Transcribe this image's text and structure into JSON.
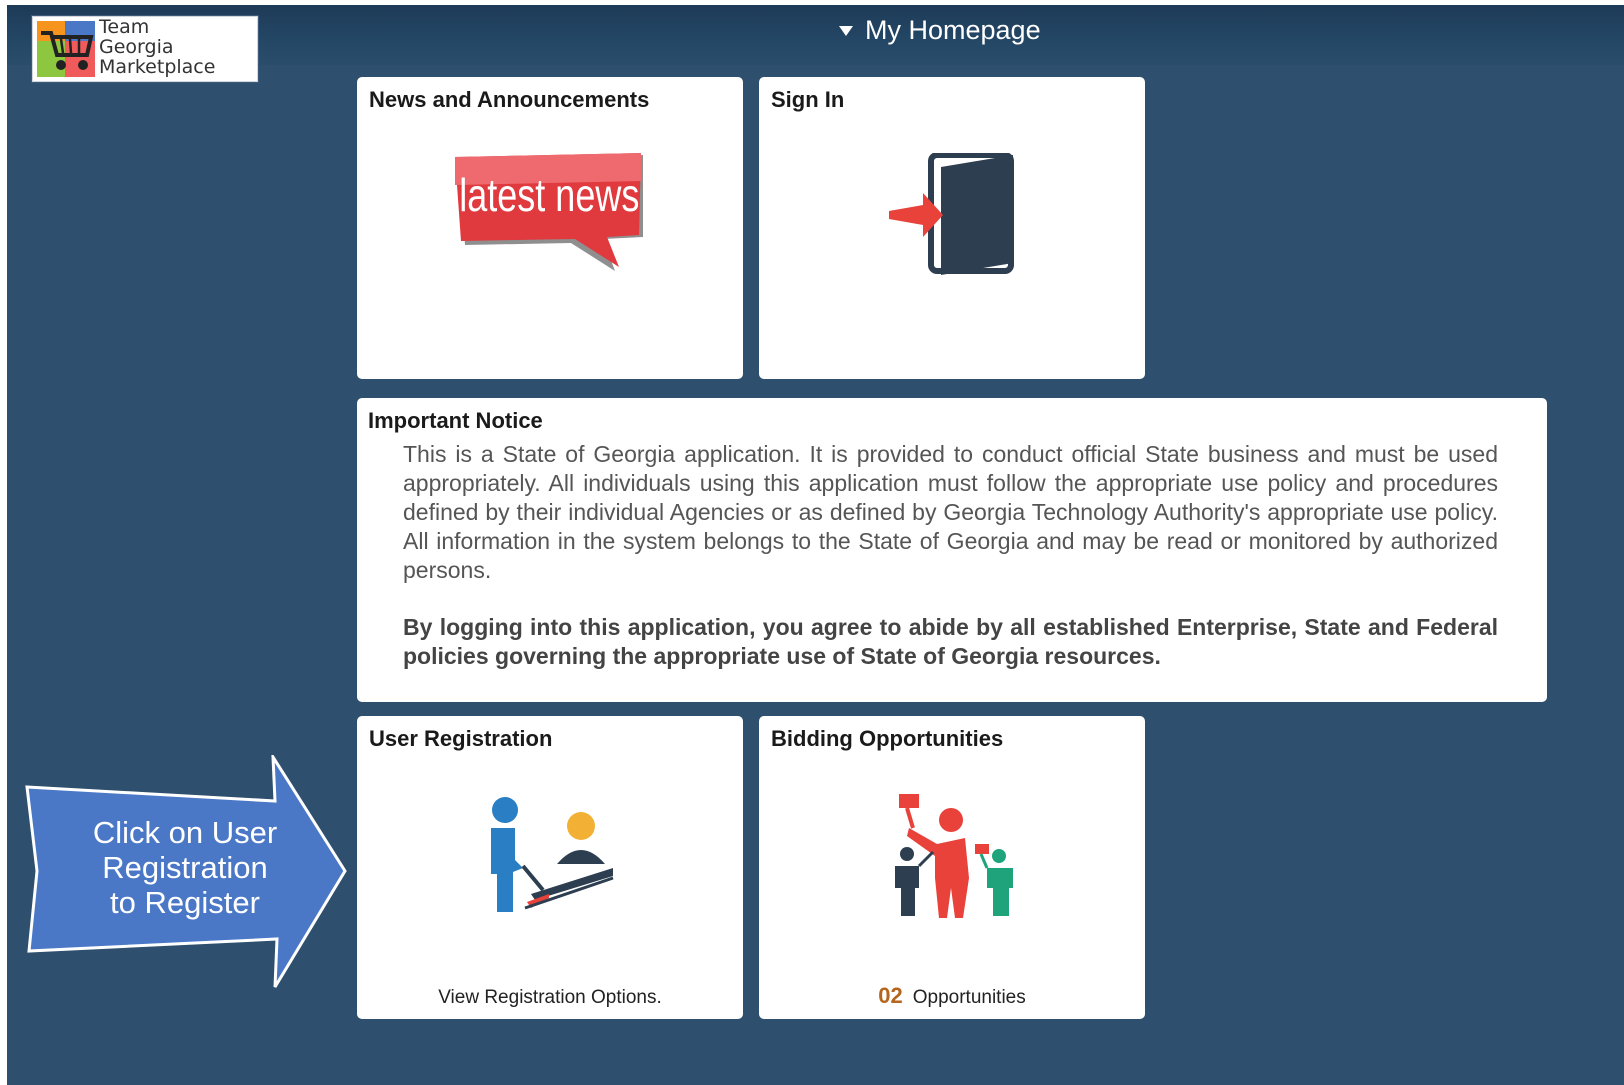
{
  "header": {
    "logo_lines": [
      "Team",
      "Georgia",
      "Marketplace"
    ],
    "title": "My Homepage"
  },
  "tiles": {
    "news": {
      "title": "News and Announcements",
      "image_text": "latest news"
    },
    "signin": {
      "title": "Sign In"
    },
    "registration": {
      "title": "User Registration",
      "footer": "View Registration Options."
    },
    "bidding": {
      "title": "Bidding Opportunities",
      "count": "02",
      "footer": "Opportunities"
    }
  },
  "notice": {
    "title": "Important Notice",
    "body": "This is a State of Georgia application. It is provided to conduct official State business and must be used appropriately. All individuals using this application must follow the appropriate use policy and procedures defined by their individual Agencies or as defined by Georgia Technology Authority's appropriate use policy. All information in the system belongs to the State of Georgia and may be read or monitored by authorized persons.",
    "bold": "By logging into this application, you agree to abide by all established Enterprise, State and Federal policies governing the appropriate use of State of Georgia resources."
  },
  "callout": {
    "lines": [
      "Click on User",
      "Registration",
      "to Register"
    ]
  },
  "colors": {
    "background": "#2e4f6d",
    "header": "#1d3b57",
    "news_red": "#e0393e",
    "arrow_blue": "#4a78c7",
    "count_orange": "#b5651d"
  }
}
